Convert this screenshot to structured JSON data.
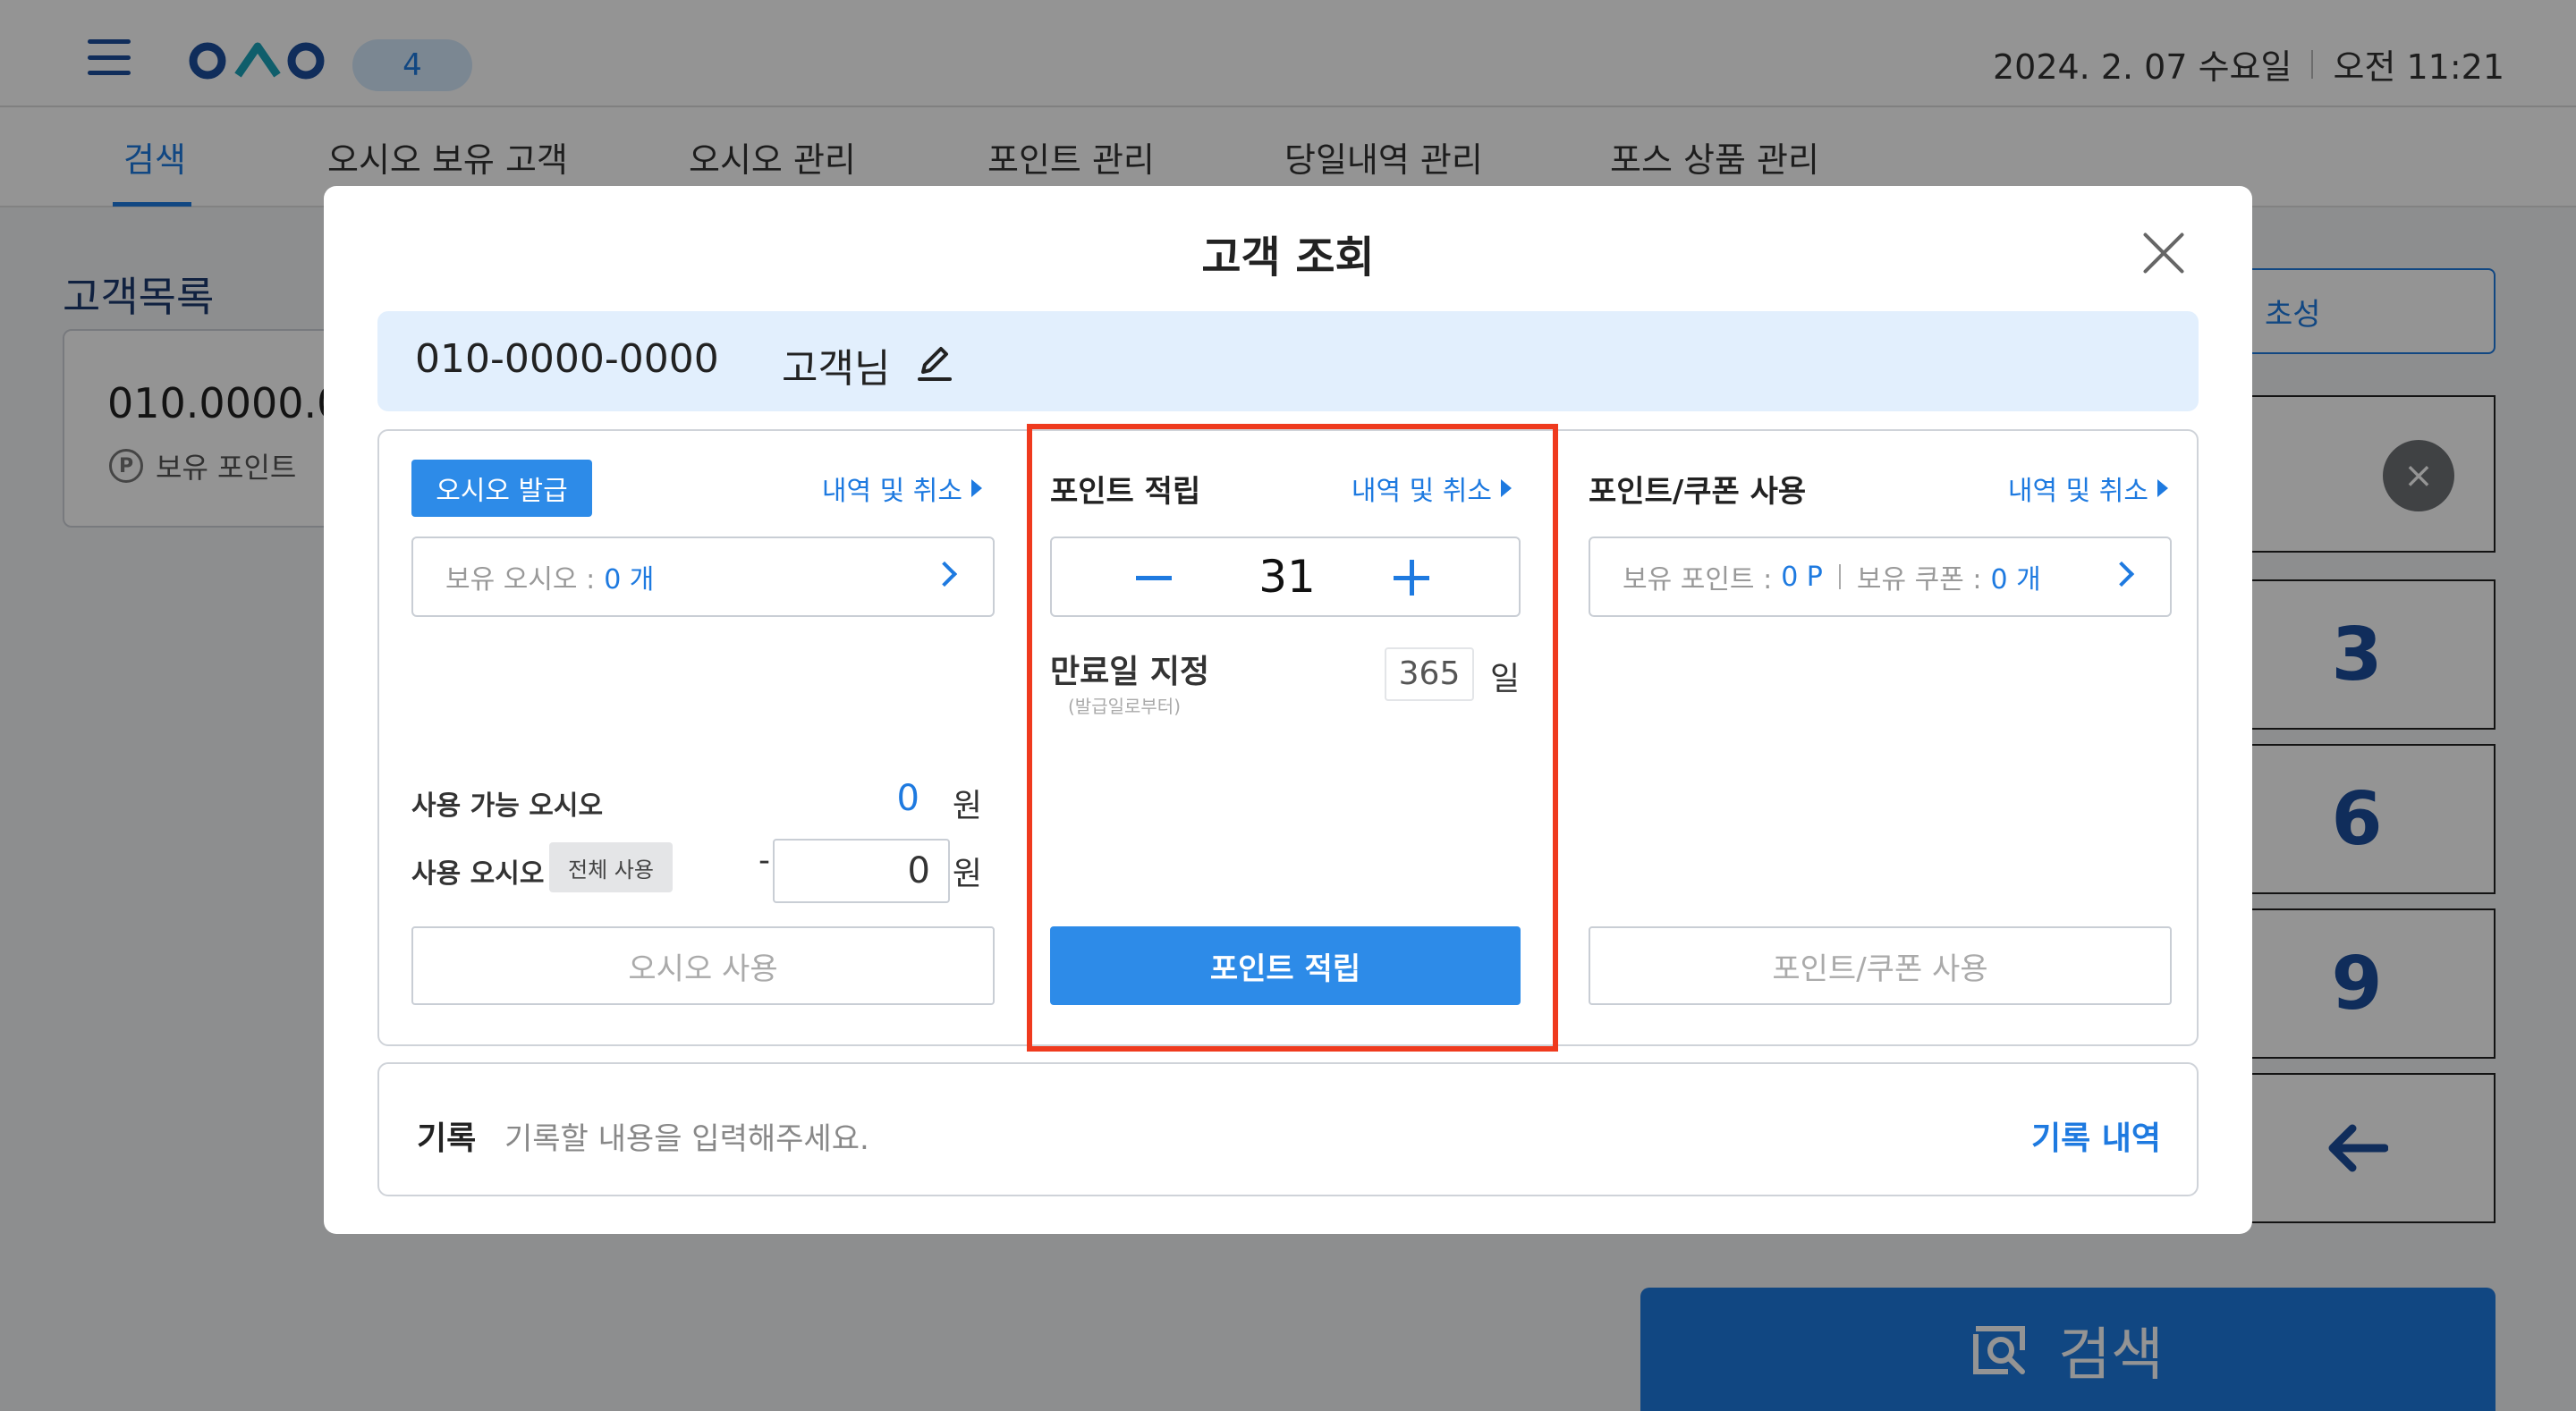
{
  "header": {
    "badge_count": "4",
    "date": "2024. 2. 07 수요일",
    "time": "오전 11:21"
  },
  "nav": {
    "tabs": [
      {
        "label": "검색",
        "active": true
      },
      {
        "label": "오시오 보유 고객"
      },
      {
        "label": "오시오 관리"
      },
      {
        "label": "포인트 관리"
      },
      {
        "label": "당일내역 관리"
      },
      {
        "label": "포스 상품 관리"
      }
    ]
  },
  "background": {
    "customer_list_title": "고객목록",
    "customer_card": {
      "phone": "010.0000.0",
      "points_label": "보유 포인트"
    },
    "initial_button": "초성",
    "keypad": [
      "3",
      "6",
      "9"
    ],
    "search_button": "검색"
  },
  "modal": {
    "title": "고객 조회",
    "customer_phone": "010-0000-0000",
    "customer_suffix": "고객님",
    "left": {
      "issue_button": "오시오 발급",
      "history_link": "내역 및 취소",
      "held_label": "보유 오시오 :",
      "held_value": "0 개",
      "available_label": "사용 가능 오시오",
      "available_value": "0",
      "won": "원",
      "use_label": "사용 오시오",
      "use_all_button": "전체 사용",
      "minus": "-",
      "use_value": "0",
      "use_button": "오시오 사용"
    },
    "middle": {
      "title": "포인트 적립",
      "history_link": "내역 및 취소",
      "quantity": "31",
      "expire_label": "만료일 지정",
      "expire_sub": "(발급일로부터)",
      "expire_days": "365",
      "days_unit": "일",
      "submit_button": "포인트 적립"
    },
    "right": {
      "title": "포인트/쿠폰 사용",
      "history_link": "내역 및 취소",
      "points_label": "보유 포인트 :",
      "points_value": "0 P",
      "coupons_label": "보유 쿠폰 :",
      "coupons_value": "0 개",
      "use_button": "포인트/쿠폰 사용"
    },
    "memo": {
      "label": "기록",
      "placeholder": "기록할 내용을 입력해주세요.",
      "history_link": "기록 내역"
    }
  },
  "colors": {
    "accent": "#1e7ae0",
    "primary_button": "#2d8be8",
    "highlight": "#ef3a1e"
  }
}
